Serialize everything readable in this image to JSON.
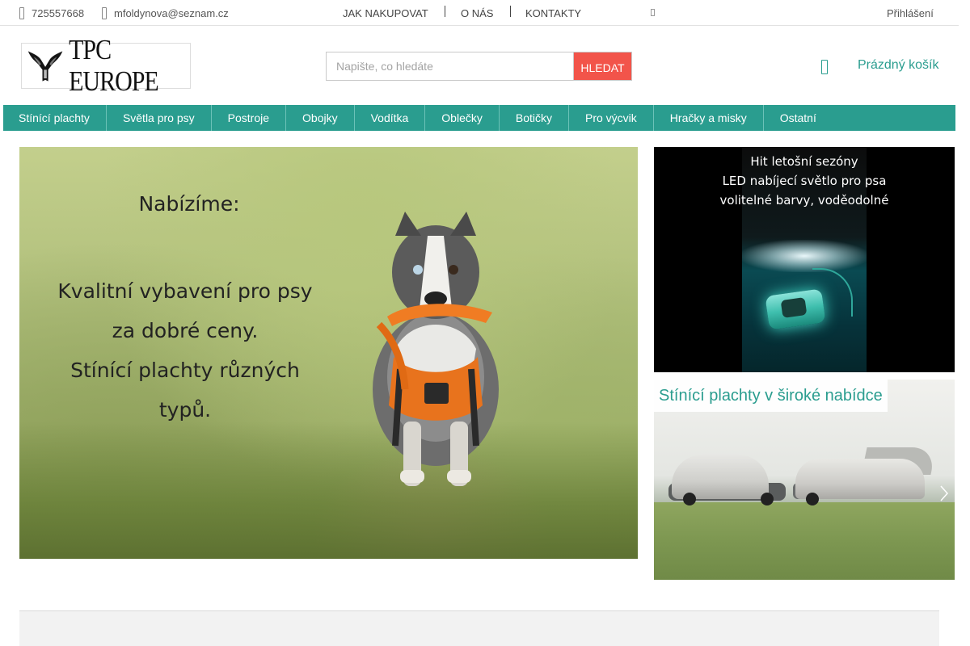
{
  "topbar": {
    "phone": "725557668",
    "email": "mfoldynova@seznam.cz",
    "links": [
      "JAK NAKUPOVAT",
      "O NÁS",
      "KONTAKTY"
    ],
    "login": "Přihlášení"
  },
  "header": {
    "logo_text": "TPC EUROPE",
    "search_placeholder": "Napište, co hledáte",
    "search_button": "HLEDAT",
    "cart_label": "Prázdný košík"
  },
  "categories": [
    "Stínící plachty",
    "Světla pro psy",
    "Postroje",
    "Obojky",
    "Vodítka",
    "Oblečky",
    "Botičky",
    "Pro výcvik",
    "Hračky a misky",
    "Ostatní"
  ],
  "hero": {
    "title": "Nabízíme:",
    "lines": [
      "Kvalitní vybavení pro psy",
      "za dobré ceny.",
      "Stínící plachty různých",
      "typů."
    ]
  },
  "promo": {
    "lines": [
      "Hit letošní sezóny",
      "LED nabíjecí světlo pro psa",
      "volitelné barvy, voděodolné"
    ]
  },
  "tarps_banner": {
    "caption": "Stínící plachty v široké nabídce"
  },
  "colors": {
    "accent": "#2a9d8f",
    "search_button": "#f2544a"
  }
}
